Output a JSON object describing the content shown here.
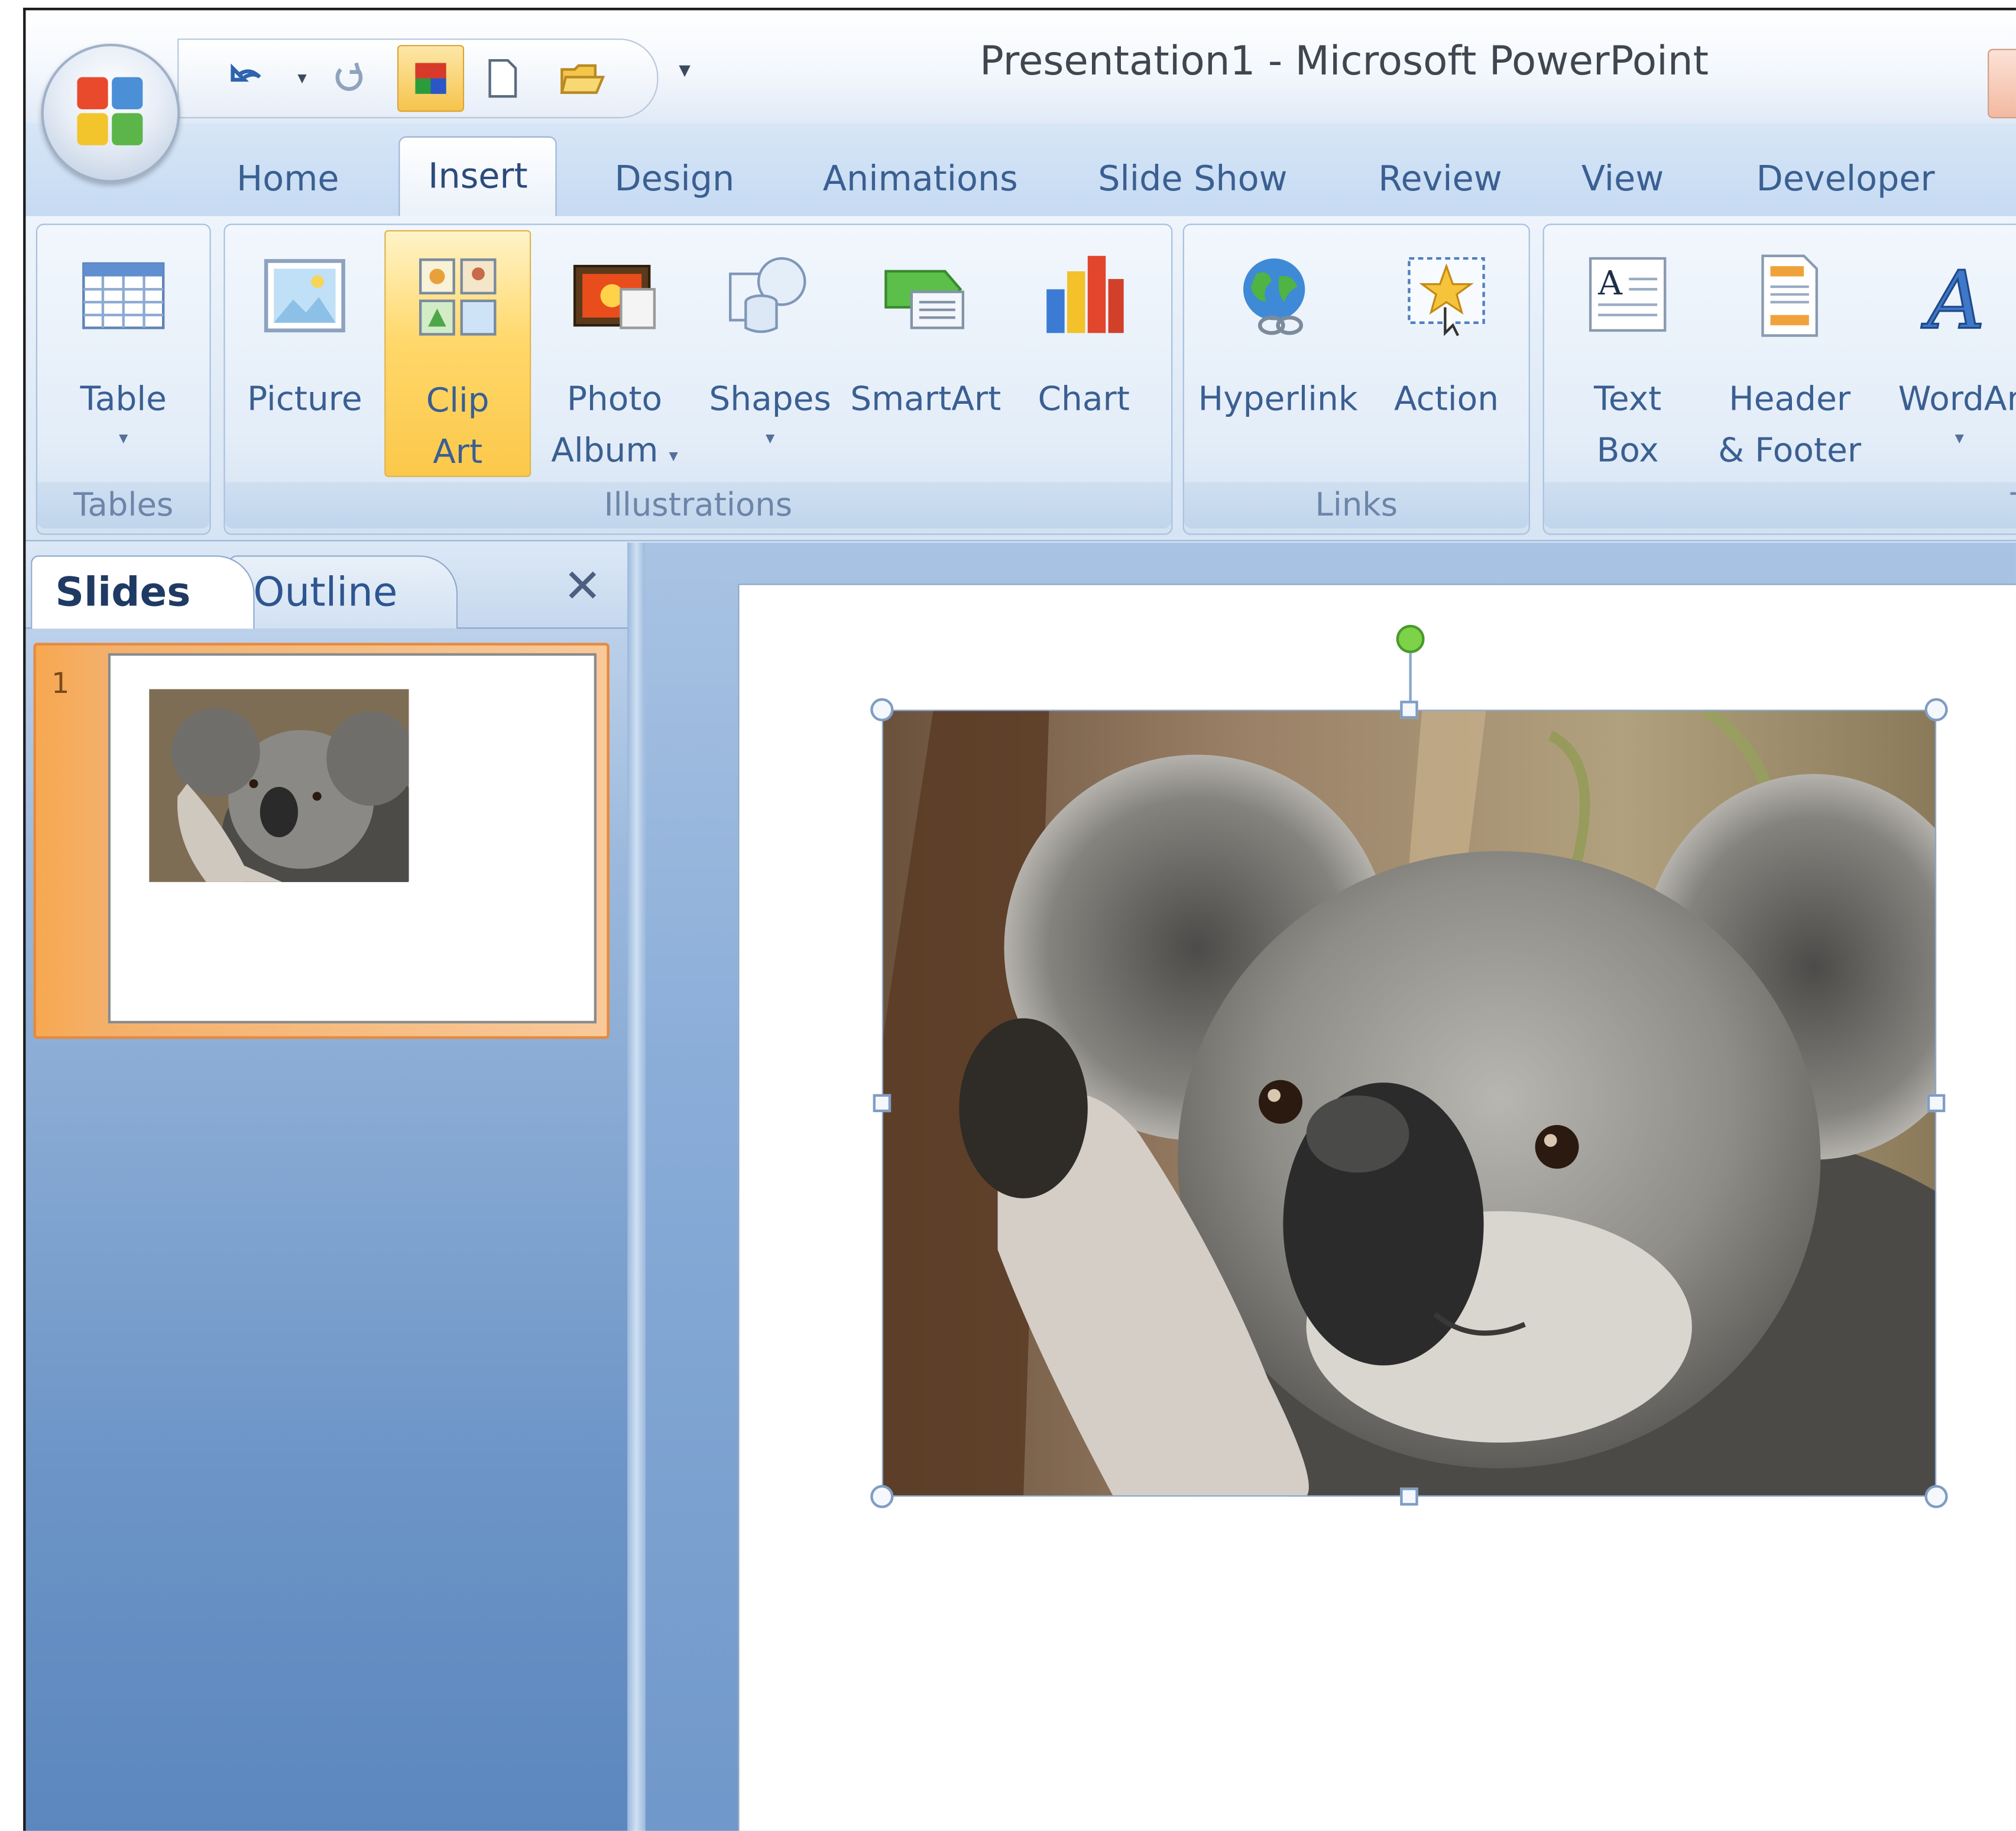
{
  "window": {
    "title": "Presentation1 - Microsoft PowerPoint"
  },
  "quick_access": {
    "items": [
      {
        "icon": "undo-icon"
      },
      {
        "icon": "undo-dropdown-icon"
      },
      {
        "icon": "redo-icon"
      },
      {
        "icon": "color-theme-icon"
      },
      {
        "icon": "new-document-icon"
      },
      {
        "icon": "open-folder-icon"
      }
    ],
    "customize_icon": "customize-dropdown-icon"
  },
  "tabs": [
    "Home",
    "Insert",
    "Design",
    "Animations",
    "Slide Show",
    "Review",
    "View",
    "Developer"
  ],
  "active_tab": "Insert",
  "ribbon": {
    "groups": {
      "tables": {
        "label": "Tables",
        "table_line1": "Table"
      },
      "illustrations": {
        "label": "Illustrations",
        "picture": "Picture",
        "clip_art_line1": "Clip",
        "clip_art_line2": "Art",
        "photo_album_line1": "Photo",
        "photo_album_line2": "Album",
        "shapes": "Shapes",
        "smartart": "SmartArt",
        "chart": "Chart"
      },
      "links": {
        "label": "Links",
        "hyperlink": "Hyperlink",
        "action": "Action"
      },
      "text": {
        "label": "T",
        "text_box_line1": "Text",
        "text_box_line2": "Box",
        "header_footer_line1": "Header",
        "header_footer_line2": "& Footer",
        "wordart": "WordAr"
      }
    }
  },
  "slides_pane": {
    "tab_slides": "Slides",
    "tab_outline": "Outline",
    "close_icon": "close-icon",
    "thumbnails": [
      {
        "number": "1"
      }
    ]
  },
  "colors": {
    "ribbon_blue": "#3a5f92",
    "hover_gold": "#fbc84a",
    "selection_orange": "#f7a850",
    "rotation_handle": "#7ed24a"
  }
}
